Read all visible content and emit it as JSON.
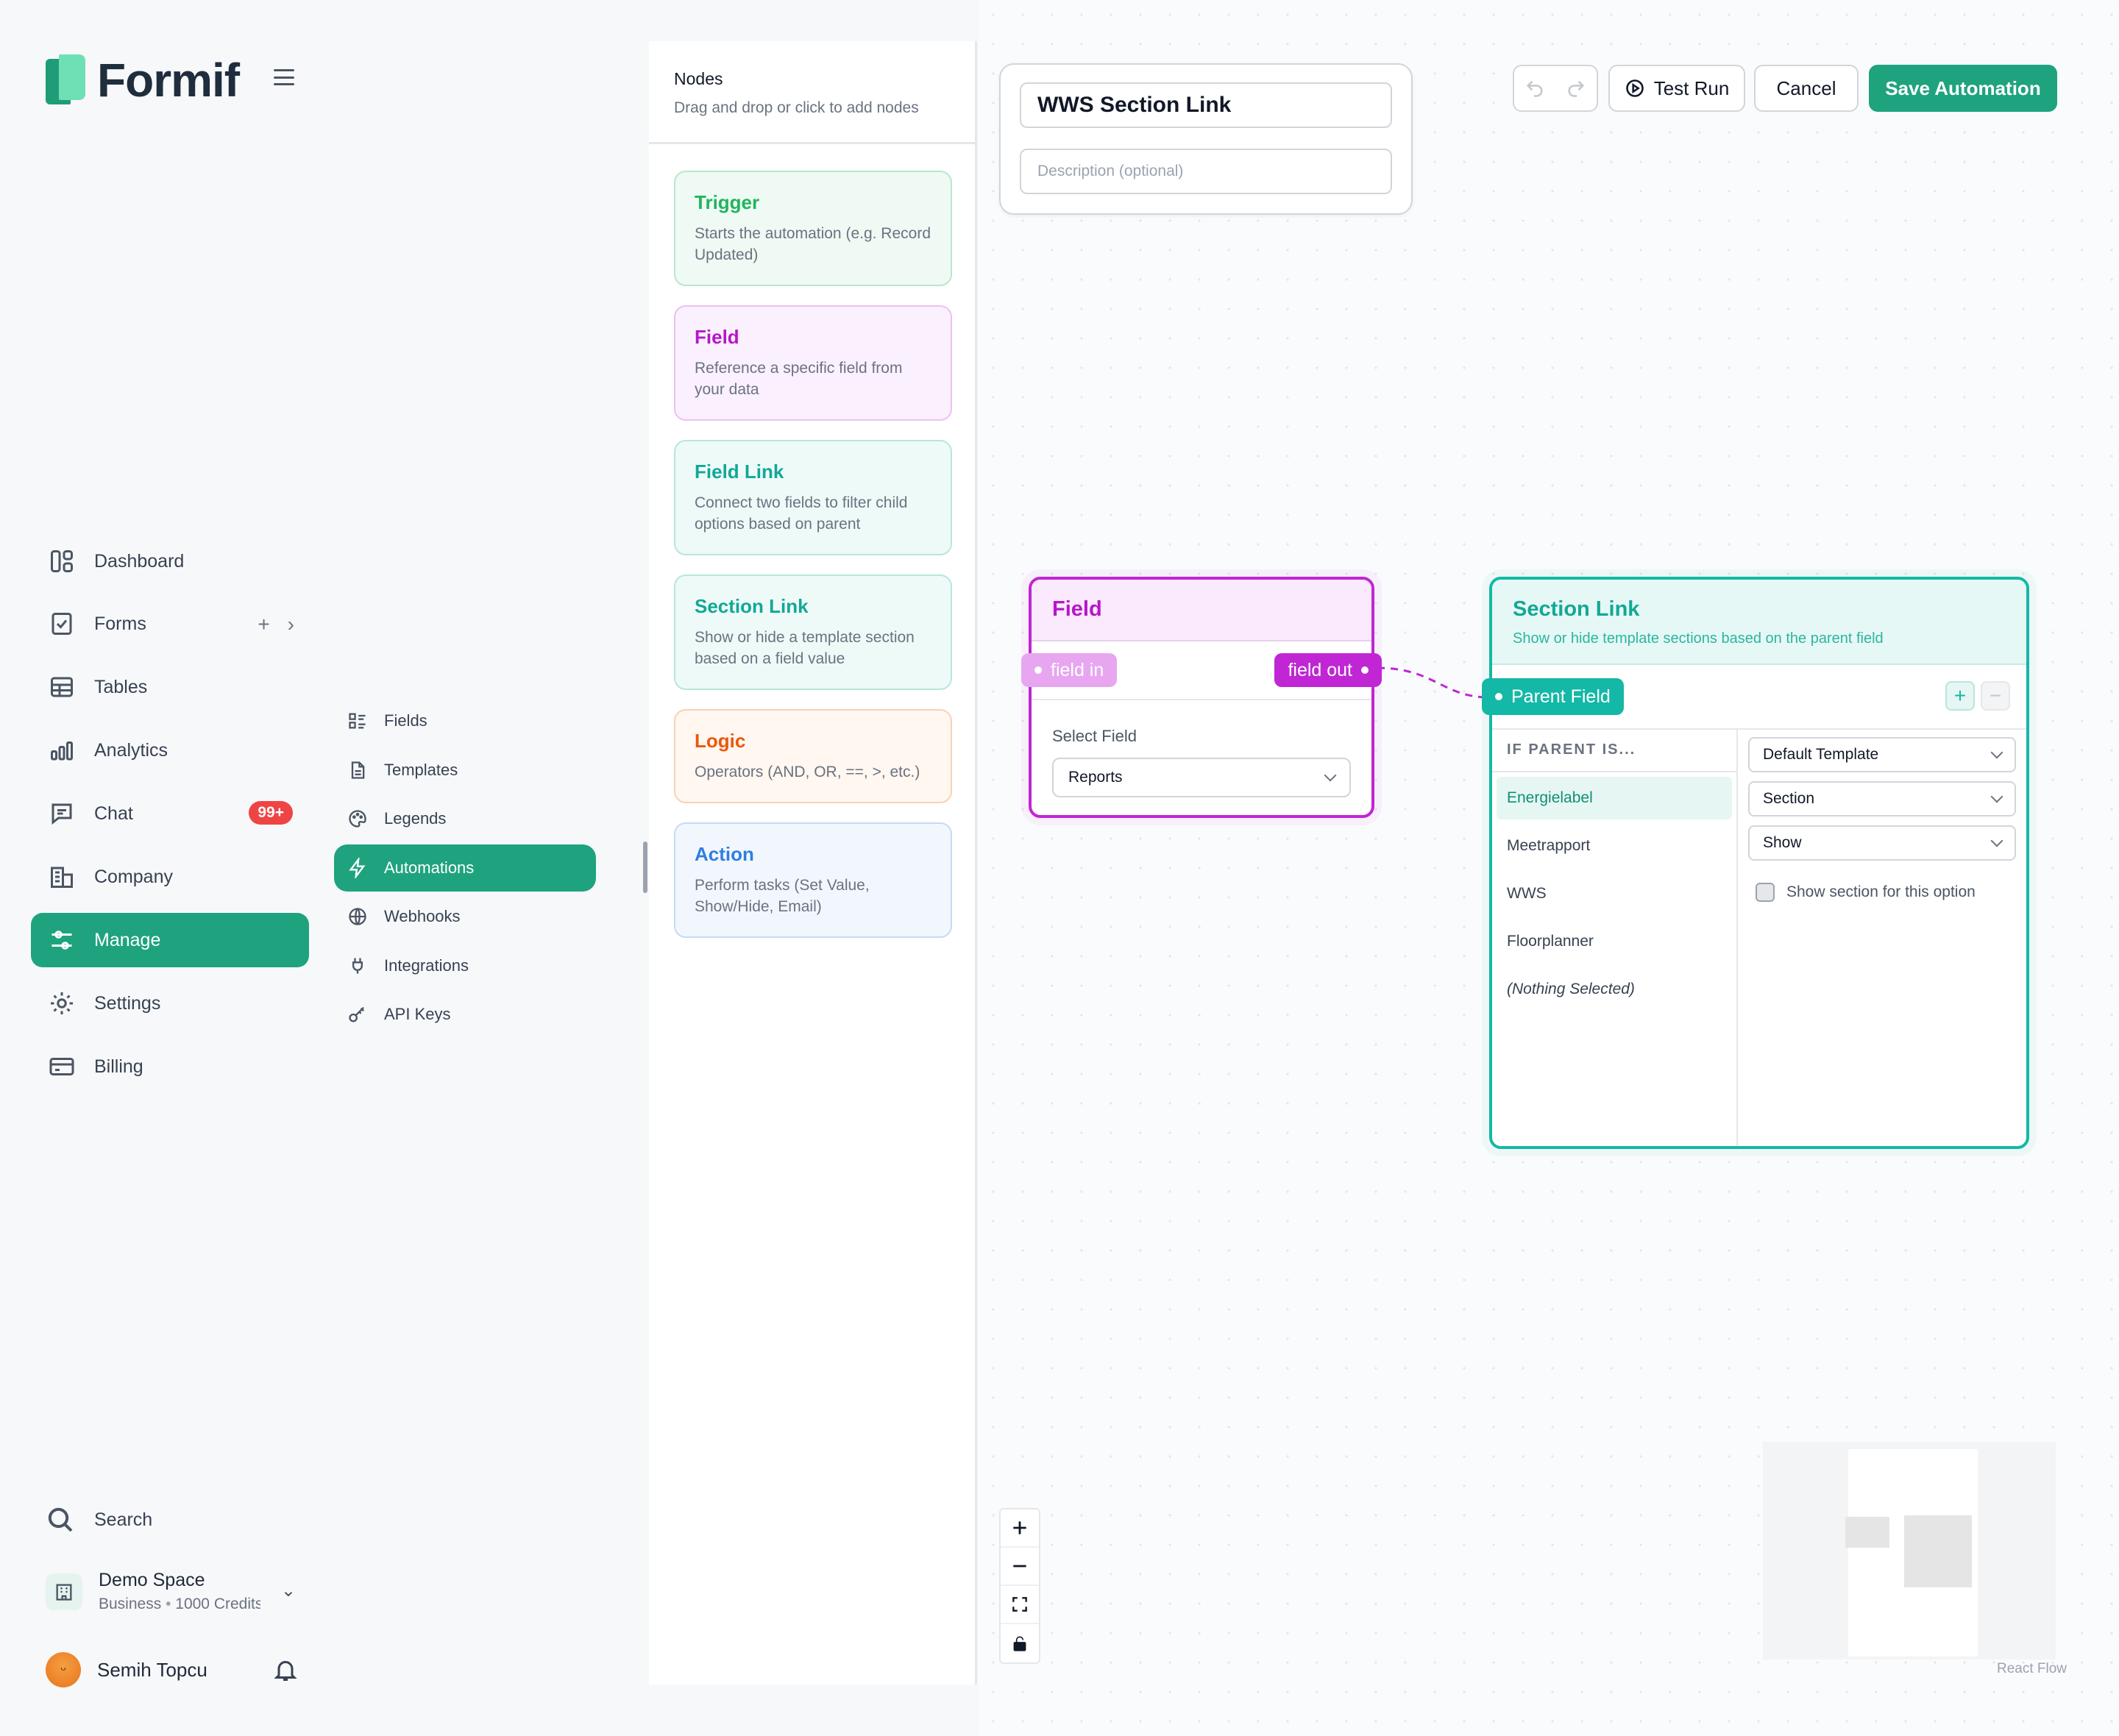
{
  "brand": {
    "name": "Formif"
  },
  "sidebar": {
    "items": [
      {
        "label": "Dashboard",
        "icon": "dashboard-icon"
      },
      {
        "label": "Forms",
        "icon": "forms-icon"
      },
      {
        "label": "Tables",
        "icon": "table-icon"
      },
      {
        "label": "Analytics",
        "icon": "analytics-icon"
      },
      {
        "label": "Chat",
        "icon": "chat-icon",
        "badge": "99+"
      },
      {
        "label": "Company",
        "icon": "building-icon"
      },
      {
        "label": "Manage",
        "icon": "sliders-icon",
        "active": true
      },
      {
        "label": "Settings",
        "icon": "gear-icon"
      },
      {
        "label": "Billing",
        "icon": "credit-card-icon"
      }
    ],
    "forms_add": "+",
    "forms_expand": "›",
    "search_label": "Search",
    "space": {
      "name": "Demo Space",
      "plan": "Business",
      "separator": "•",
      "credits": "1000 Credits"
    },
    "user": {
      "name": "Semih Topcu"
    }
  },
  "subnav": {
    "items": [
      {
        "label": "Fields",
        "icon": "list-icon"
      },
      {
        "label": "Templates",
        "icon": "document-icon"
      },
      {
        "label": "Legends",
        "icon": "palette-icon"
      },
      {
        "label": "Automations",
        "icon": "lightning-icon",
        "active": true
      },
      {
        "label": "Webhooks",
        "icon": "globe-icon"
      },
      {
        "label": "Integrations",
        "icon": "plug-icon"
      },
      {
        "label": "API Keys",
        "icon": "key-icon"
      }
    ]
  },
  "palette": {
    "title": "Nodes",
    "subtitle": "Drag and drop or click to add nodes",
    "nodes": [
      {
        "title": "Trigger",
        "desc": "Starts the automation (e.g. Record Updated)",
        "color": "#22b45e",
        "bg": "#effaf4",
        "border": "#b9e7cc"
      },
      {
        "title": "Field",
        "desc": "Reference a specific field from your data",
        "color": "#b517c8",
        "bg": "#fbf0fd",
        "border": "#ecc0f2"
      },
      {
        "title": "Field Link",
        "desc": "Connect two fields to filter child options based on parent",
        "color": "#12a896",
        "bg": "#eefaf8",
        "border": "#b7e6de"
      },
      {
        "title": "Section Link",
        "desc": "Show or hide a template section based on a field value",
        "color": "#12a896",
        "bg": "#eefaf8",
        "border": "#b7e6de"
      },
      {
        "title": "Logic",
        "desc": "Operators (AND, OR, ==, >, etc.)",
        "color": "#ea580c",
        "bg": "#fff7f0",
        "border": "#f8d2b4"
      },
      {
        "title": "Action",
        "desc": "Perform tasks (Set Value, Show/Hide, Email)",
        "color": "#2f7fe0",
        "bg": "#f2f7fe",
        "border": "#c4daf6"
      }
    ]
  },
  "automation": {
    "name": "WWS Section Link",
    "description_placeholder": "Description (optional)"
  },
  "toolbar": {
    "test_run": "Test Run",
    "cancel": "Cancel",
    "save": "Save Automation"
  },
  "field_node": {
    "title": "Field",
    "handle_in": "field in",
    "handle_out": "field out",
    "select_label": "Select Field",
    "selected": "Reports"
  },
  "section_link_node": {
    "title": "Section Link",
    "subtitle": "Show or hide template sections based on the parent field",
    "handle": "Parent Field",
    "add": "+",
    "remove": "−",
    "column_header": "IF PARENT IS...",
    "options": [
      "Energielabel",
      "Meetrapport",
      "WWS",
      "Floorplanner",
      "(Nothing Selected)"
    ],
    "selected_option": "Energielabel",
    "template_select": "Default Template",
    "section_select": "Section",
    "action_select": "Show",
    "checkbox_label": "Show section for this option"
  },
  "canvas": {
    "attribution": "React Flow"
  },
  "colors": {
    "accent": "#1fa37f",
    "field": "#c026d3",
    "section_link": "#14b8a6",
    "badge": "#ef4444"
  }
}
